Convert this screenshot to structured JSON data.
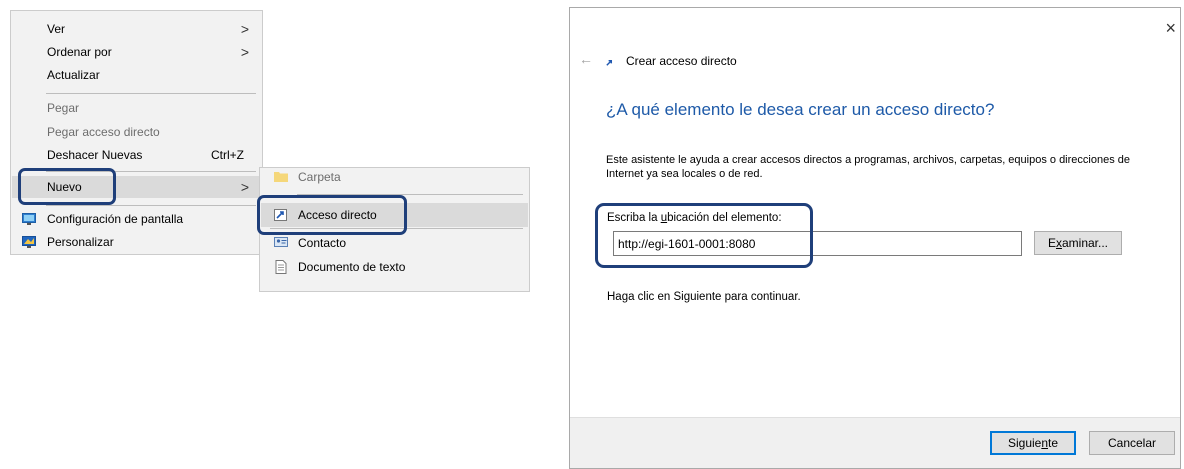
{
  "context_menu": {
    "items": [
      {
        "label": "Ver",
        "submenu": true
      },
      {
        "label": "Ordenar por",
        "submenu": true
      },
      {
        "label": "Actualizar"
      },
      {
        "label": "Pegar",
        "disabled": true
      },
      {
        "label": "Pegar acceso directo",
        "disabled": true
      },
      {
        "label": "Deshacer Nuevas",
        "shortcut": "Ctrl+Z"
      },
      {
        "label": "Nuevo",
        "submenu": true,
        "selected": true
      },
      {
        "label": "Configuración de pantalla",
        "icon": "display-settings-icon"
      },
      {
        "label": "Personalizar",
        "icon": "personalize-icon"
      }
    ],
    "submenu_chevron": ">"
  },
  "submenu": {
    "items": [
      {
        "label": "Carpeta",
        "icon": "folder-icon"
      },
      {
        "label": "Acceso directo",
        "icon": "shortcut-icon",
        "selected": true
      },
      {
        "label": "Contacto",
        "icon": "contact-icon"
      },
      {
        "label": "Documento de texto",
        "icon": "text-document-icon"
      }
    ]
  },
  "wizard": {
    "close_glyph": "×",
    "back_glyph": "←",
    "title": "Crear acceso directo",
    "heading": "¿A qué elemento le desea crear un acceso directo?",
    "description": "Este asistente le ayuda a crear accesos directos a programas, archivos, carpetas, equipos o direcciones de Internet ya sea locales o de red.",
    "location_label_pre": "Escriba la ",
    "location_label_u": "u",
    "location_label_post": "bicación del elemento:",
    "location_value": "http://egi-1601-0001:8080",
    "browse_label_pre": "E",
    "browse_label_u": "x",
    "browse_label_post": "aminar...",
    "hint": "Haga clic en Siguiente para continuar.",
    "next_pre": "Siguie",
    "next_u": "n",
    "next_post": "te",
    "cancel_label": "Cancelar"
  },
  "colors": {
    "heading": "#1e5aa8",
    "highlight_border": "#1f3f7a",
    "menu_background": "#f2f2f2",
    "default_button_border": "#0078d7"
  }
}
